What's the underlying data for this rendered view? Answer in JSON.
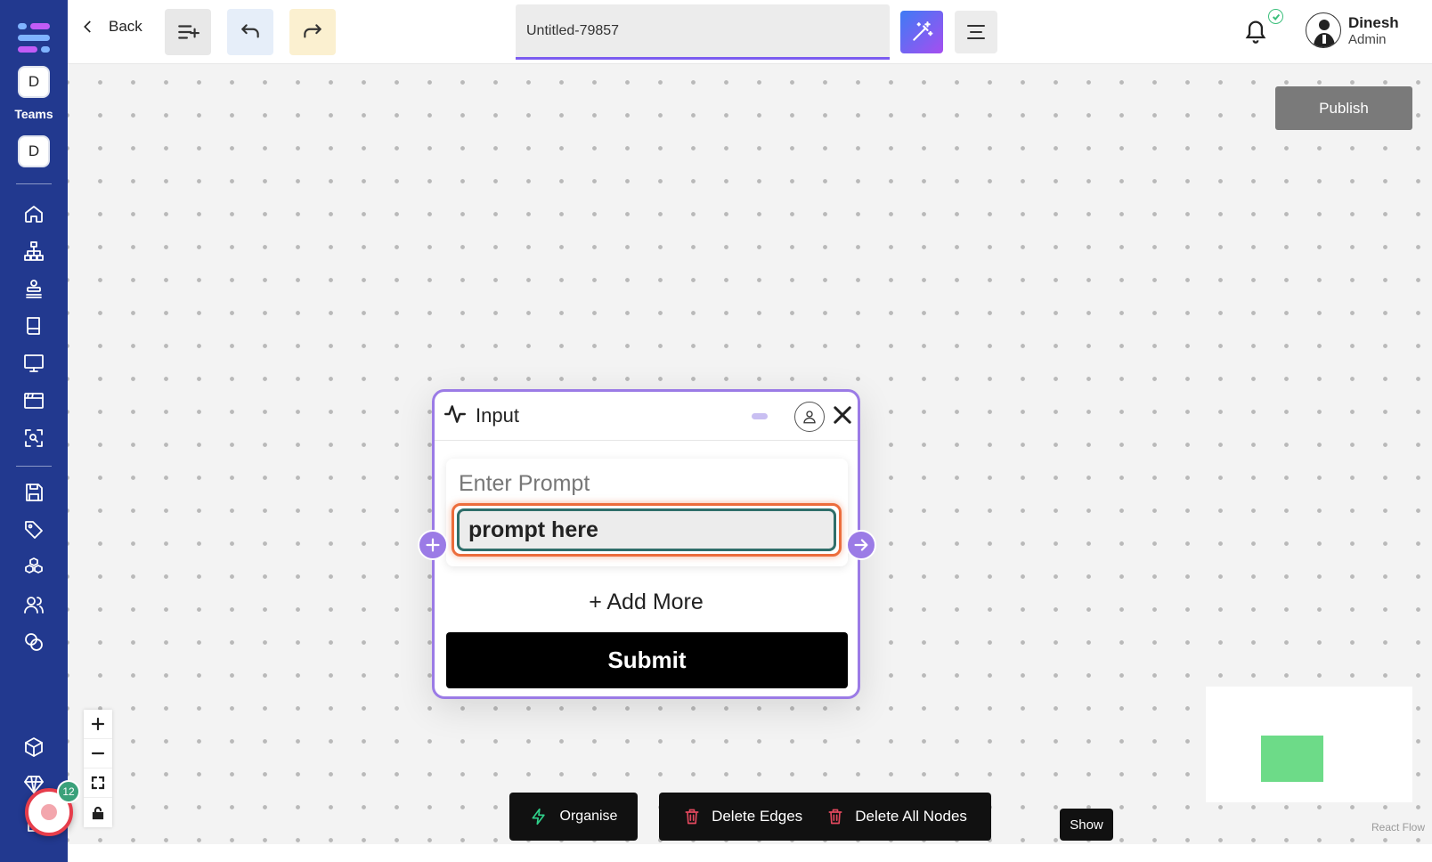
{
  "sidebar": {
    "team_avatar_1": "D",
    "teams_label": "Teams",
    "team_avatar_2": "D",
    "icons": [
      "home-icon",
      "sitemap-icon",
      "stack-icon",
      "book-icon",
      "monitor-icon",
      "browser-window-icon",
      "scan-icon",
      "save-icon",
      "tag-icon",
      "cubes-icon",
      "users-icon",
      "coins-icon",
      "package-icon",
      "diamond-icon",
      "document-icon"
    ],
    "accent": "#22398f"
  },
  "header": {
    "back_label": "Back",
    "title_value": "Untitled-79857",
    "user_name": "Dinesh",
    "user_role": "Admin"
  },
  "canvas": {
    "publish_label": "Publish",
    "node": {
      "title": "Input",
      "prompt_label": "Enter Prompt",
      "prompt_value": "prompt here",
      "add_more_label": "+ Add More",
      "submit_label": "Submit"
    },
    "toolbar": {
      "organise_label": "Organise",
      "delete_edges_label": "Delete Edges",
      "delete_all_nodes_label": "Delete All Nodes",
      "show_label": "Show"
    },
    "attribution": "React Flow"
  },
  "bubble": {
    "badge_count": "12"
  },
  "colors": {
    "node_border": "#9b7be6",
    "publish_bg": "#7a7a7a",
    "minimap_node": "#6ddb88"
  }
}
